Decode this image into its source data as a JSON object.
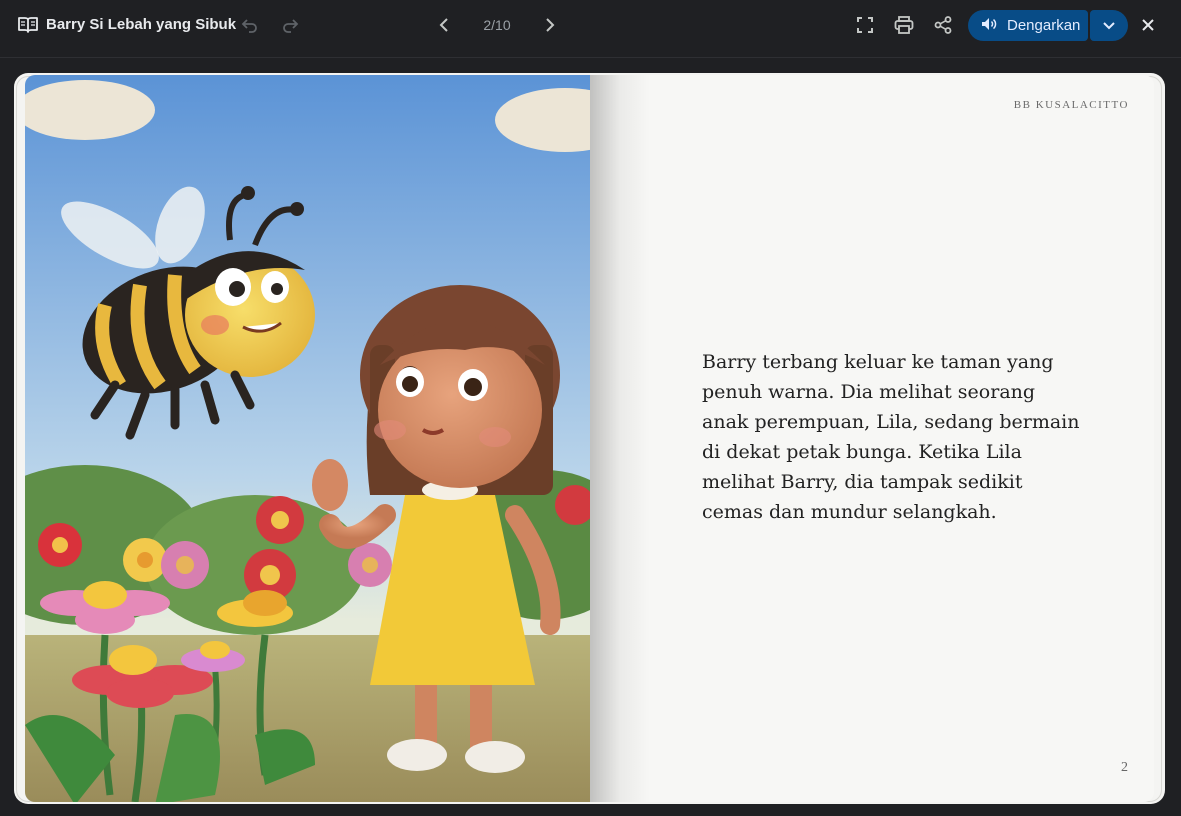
{
  "toolbar": {
    "title": "Barry Si Lebah yang Sibuk",
    "page_indicator": "2/10",
    "listen_label": "Dengarkan",
    "icons": [
      "book-icon",
      "undo-icon",
      "redo-icon",
      "chevron-left-icon",
      "chevron-right-icon",
      "fullscreen-icon",
      "print-icon",
      "share-icon",
      "speaker-icon",
      "chevron-down-icon",
      "close-icon"
    ]
  },
  "page": {
    "author": "BB KUSALACITTO",
    "story_lines": [
      "Barry terbang keluar ke taman yang",
      "penuh warna. Dia melihat seorang",
      "anak perempuan, Lila, sedang bermain",
      "di dekat petak bunga. Ketika Lila",
      "melihat Barry, dia tampak sedikit",
      "cemas dan mundur selangkah."
    ],
    "page_number": "2"
  },
  "colors": {
    "toolbar_bg": "#1f2023",
    "accent_button": "#084c87",
    "page_bg": "#f7f7f5"
  }
}
